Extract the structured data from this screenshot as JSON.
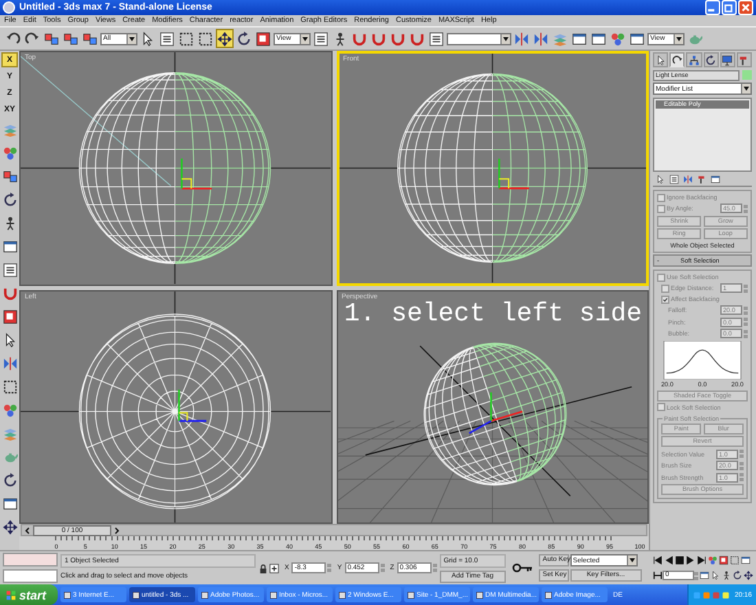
{
  "window": {
    "title": "Untitled   - 3ds max 7   - Stand-alone License"
  },
  "menu": [
    "File",
    "Edit",
    "Tools",
    "Group",
    "Views",
    "Create",
    "Modifiers",
    "Character",
    "reactor",
    "Animation",
    "Graph Editors",
    "Rendering",
    "Customize",
    "MAXScript",
    "Help"
  ],
  "toolbar": [
    {
      "kind": "button",
      "selected": false
    },
    {
      "kind": "button",
      "selected": false
    },
    {
      "kind": "button",
      "selected": false
    },
    {
      "kind": "button",
      "selected": false
    },
    {
      "kind": "button",
      "selected": false
    },
    {
      "kind": "dropdown",
      "value": "All"
    },
    {
      "kind": "button",
      "selected": false
    },
    {
      "kind": "button",
      "selected": false
    },
    {
      "kind": "button",
      "selected": false
    },
    {
      "kind": "button",
      "selected": false
    },
    {
      "kind": "button",
      "selected": true
    },
    {
      "kind": "button",
      "selected": false
    },
    {
      "kind": "button",
      "selected": false
    },
    {
      "kind": "dropdown",
      "value": "View"
    },
    {
      "kind": "button",
      "selected": false
    },
    {
      "kind": "button",
      "selected": false
    },
    {
      "kind": "button",
      "selected": false
    },
    {
      "kind": "button",
      "selected": false
    },
    {
      "kind": "button",
      "selected": false
    },
    {
      "kind": "button",
      "selected": false
    },
    {
      "kind": "button",
      "selected": false
    },
    {
      "kind": "dropdown"
    },
    {
      "kind": "button",
      "selected": false
    },
    {
      "kind": "button",
      "selected": false
    },
    {
      "kind": "button",
      "selected": false
    },
    {
      "kind": "button",
      "selected": false
    },
    {
      "kind": "button",
      "selected": false
    },
    {
      "kind": "button",
      "selected": false
    },
    {
      "kind": "button",
      "selected": false
    },
    {
      "kind": "dropdown",
      "value": "View"
    },
    {
      "kind": "button",
      "selected": false
    }
  ],
  "axis_constraints": [
    {
      "label": "X",
      "selected": true
    },
    {
      "label": "Y",
      "selected": false
    },
    {
      "label": "Z",
      "selected": false
    },
    {
      "label": "XY",
      "selected": false
    }
  ],
  "viewports": [
    {
      "label": "Top",
      "kind": "top",
      "active": false
    },
    {
      "label": "Front",
      "kind": "front",
      "active": true
    },
    {
      "label": "Left",
      "kind": "left",
      "active": false
    },
    {
      "label": "Perspective",
      "kind": "perspective",
      "active": false
    }
  ],
  "annotation": "1. select left side",
  "command_panel": {
    "tabs": [
      {
        "selected": false
      },
      {
        "selected": true
      },
      {
        "selected": false
      },
      {
        "selected": false
      },
      {
        "selected": false
      },
      {
        "selected": false
      }
    ],
    "object_name": "Light Lense",
    "modifier_list": "Modifier List",
    "stack": [
      {
        "label": "Editable Poly",
        "selected": true
      }
    ],
    "selection": {
      "disabled": true,
      "ignore_backfacing": {
        "label": "Ignore Backfacing",
        "checked": false
      },
      "by_angle": {
        "label": "By Angle:",
        "checked": false,
        "value": "45.0"
      },
      "buttons": [
        "Shrink",
        "Grow",
        "Ring",
        "Loop"
      ],
      "status": "Whole Object Selected"
    },
    "soft_selection": {
      "sign": "-",
      "title": "Soft Selection",
      "disabled": true,
      "use_soft_selection": {
        "label": "Use Soft Selection",
        "checked": false
      },
      "edge_distance": {
        "label": "Edge Distance:",
        "checked": false,
        "value": "1"
      },
      "affect_backfacing": {
        "label": "Affect Backfacing",
        "checked": true
      },
      "spinners": [
        {
          "label": "Falloff:",
          "value": "20.0"
        },
        {
          "label": "Pinch:",
          "value": "0.0"
        },
        {
          "label": "Bubble:",
          "value": "0.0"
        }
      ],
      "curve_labels": [
        "20.0",
        "0.0",
        "20.0"
      ],
      "shaded_face_toggle": "Shaded Face Toggle",
      "lock_soft_selection": {
        "label": "Lock Soft Selection",
        "checked": false
      },
      "paint": {
        "title": "Paint Soft Selection",
        "buttons": [
          "Paint",
          "Blur"
        ],
        "revert": "Revert",
        "spinners": [
          {
            "label": "Selection Value",
            "value": "1.0"
          },
          {
            "label": "Brush Size",
            "value": "20.0"
          },
          {
            "label": "Brush Strength",
            "value": "1.0"
          }
        ],
        "options": "Brush Options"
      }
    }
  },
  "timeline": {
    "position": "0 / 100",
    "level": 0,
    "ticks": [
      "0",
      "5",
      "10",
      "15",
      "20",
      "25",
      "30",
      "35",
      "40",
      "45",
      "50",
      "55",
      "60",
      "65",
      "70",
      "75",
      "80",
      "85",
      "90",
      "95",
      "100"
    ]
  },
  "status": {
    "selection": "1 Object Selected",
    "prompt": "Click and drag to select and move objects",
    "coords": [
      {
        "label": "X",
        "value": "-8.3"
      },
      {
        "label": "Y",
        "value": "0.452"
      },
      {
        "label": "Z",
        "value": "0.306"
      }
    ],
    "grid": "Grid = 10.0",
    "time_tag": "Add Time Tag",
    "auto_key": {
      "label": "Auto Key",
      "on": false
    },
    "key_mode": "Selected",
    "set_key": "Set Key",
    "key_filters": "Key Filters...",
    "frame": "0"
  },
  "taskbar": {
    "start": "start",
    "tasks": [
      {
        "label": "3 Internet E...",
        "selected": false
      },
      {
        "label": "untitled - 3ds ...",
        "selected": true
      },
      {
        "label": "Adobe Photos...",
        "selected": false
      },
      {
        "label": "Inbox - Micros...",
        "selected": false
      },
      {
        "label": "2 Windows E...",
        "selected": false
      },
      {
        "label": "Site - 1_DMM_...",
        "selected": false
      },
      {
        "label": "DM Multimedia...",
        "selected": false
      },
      {
        "label": "Adobe Image...",
        "selected": false
      }
    ],
    "language": "DE",
    "clock": "20:16"
  }
}
